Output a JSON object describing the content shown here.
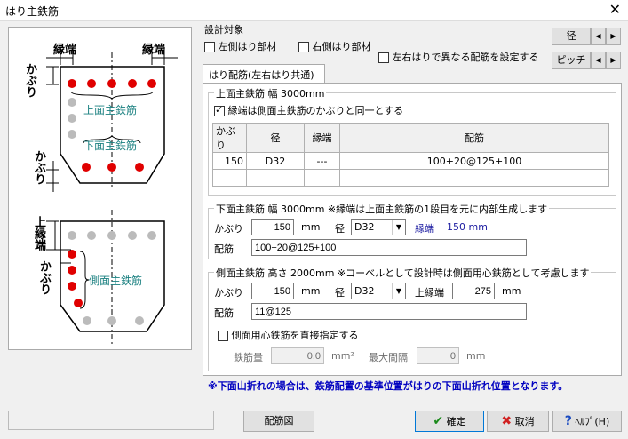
{
  "window": {
    "title": "はり主鉄筋",
    "close": "✕"
  },
  "diagram": {
    "edge_left": "縁端",
    "edge_right": "縁端",
    "cover_top": "かぶり",
    "top_bar_label": "上面主鉄筋",
    "bottom_bar_label": "下面主鉄筋",
    "cover_bottom": "かぶり",
    "upper_edge": "上縁端",
    "cover_side": "かぶり",
    "side_bar_label": "側面主鉄筋"
  },
  "design_target": {
    "legend": "設計対象",
    "left_beam": "左側はり部材",
    "right_beam": "右側はり部材",
    "left_checked": false,
    "right_checked": false
  },
  "diff_arrangement": {
    "label": "左右はりで異なる配筋を設定する",
    "checked": false
  },
  "spin_diameter": {
    "label": "径",
    "left": "◀",
    "right": "▶"
  },
  "spin_pitch": {
    "label": "ピッチ",
    "left": "◀",
    "right": "▶"
  },
  "tab": {
    "label": "はり配筋(左右はり共通)"
  },
  "top_group": {
    "legend": "上面主鉄筋 幅 3000mm",
    "same_cover_label": "縁端は側面主鉄筋のかぶりと同一とする",
    "same_cover_checked": true,
    "columns": [
      "かぶり",
      "径",
      "縁端",
      "配筋"
    ],
    "rows": [
      [
        "150",
        "D32",
        "---",
        "100+20@125+100"
      ]
    ]
  },
  "bottom_group": {
    "legend": "下面主鉄筋 幅 3000mm ※縁端は上面主鉄筋の1段目を元に内部生成します",
    "cover_label": "かぶり",
    "cover": "150",
    "unit_mm": "mm",
    "dia_label": "径",
    "dia": "D32",
    "edge_label": "縁端",
    "edge_value": "150 mm",
    "arr_label": "配筋",
    "arrangement": "100+20@125+100"
  },
  "side_group": {
    "legend": "側面主鉄筋 高さ 2000mm ※コーベルとして設計時は側面用心鉄筋として考慮します",
    "cover_label": "かぶり",
    "cover": "150",
    "unit_mm": "mm",
    "dia_label": "径",
    "dia": "D32",
    "upper_edge_label": "上縁端",
    "upper_edge": "275",
    "unit_mm2": "mm",
    "arr_label": "配筋",
    "arrangement": "11@125",
    "direct_label": "側面用心鉄筋を直接指定する",
    "direct_checked": false,
    "amount_label": "鉄筋量",
    "amount": "0.0",
    "amount_unit": "mm²",
    "max_gap_label": "最大間隔",
    "max_gap": "0",
    "max_gap_unit": "mm"
  },
  "note": "※下面山折れの場合は、鉄筋配置の基準位置がはりの下面山折れ位置となります。",
  "footer": {
    "status": "",
    "layout_button": "配筋図",
    "ok": "確定",
    "cancel": "取消",
    "help": "ﾍﾙﾌﾟ(H)"
  },
  "colors": {
    "rebar_red": "#e00000",
    "rebar_grey": "#bbbbbb",
    "label_teal": "#1a8080",
    "note_blue": "#0000c0"
  }
}
